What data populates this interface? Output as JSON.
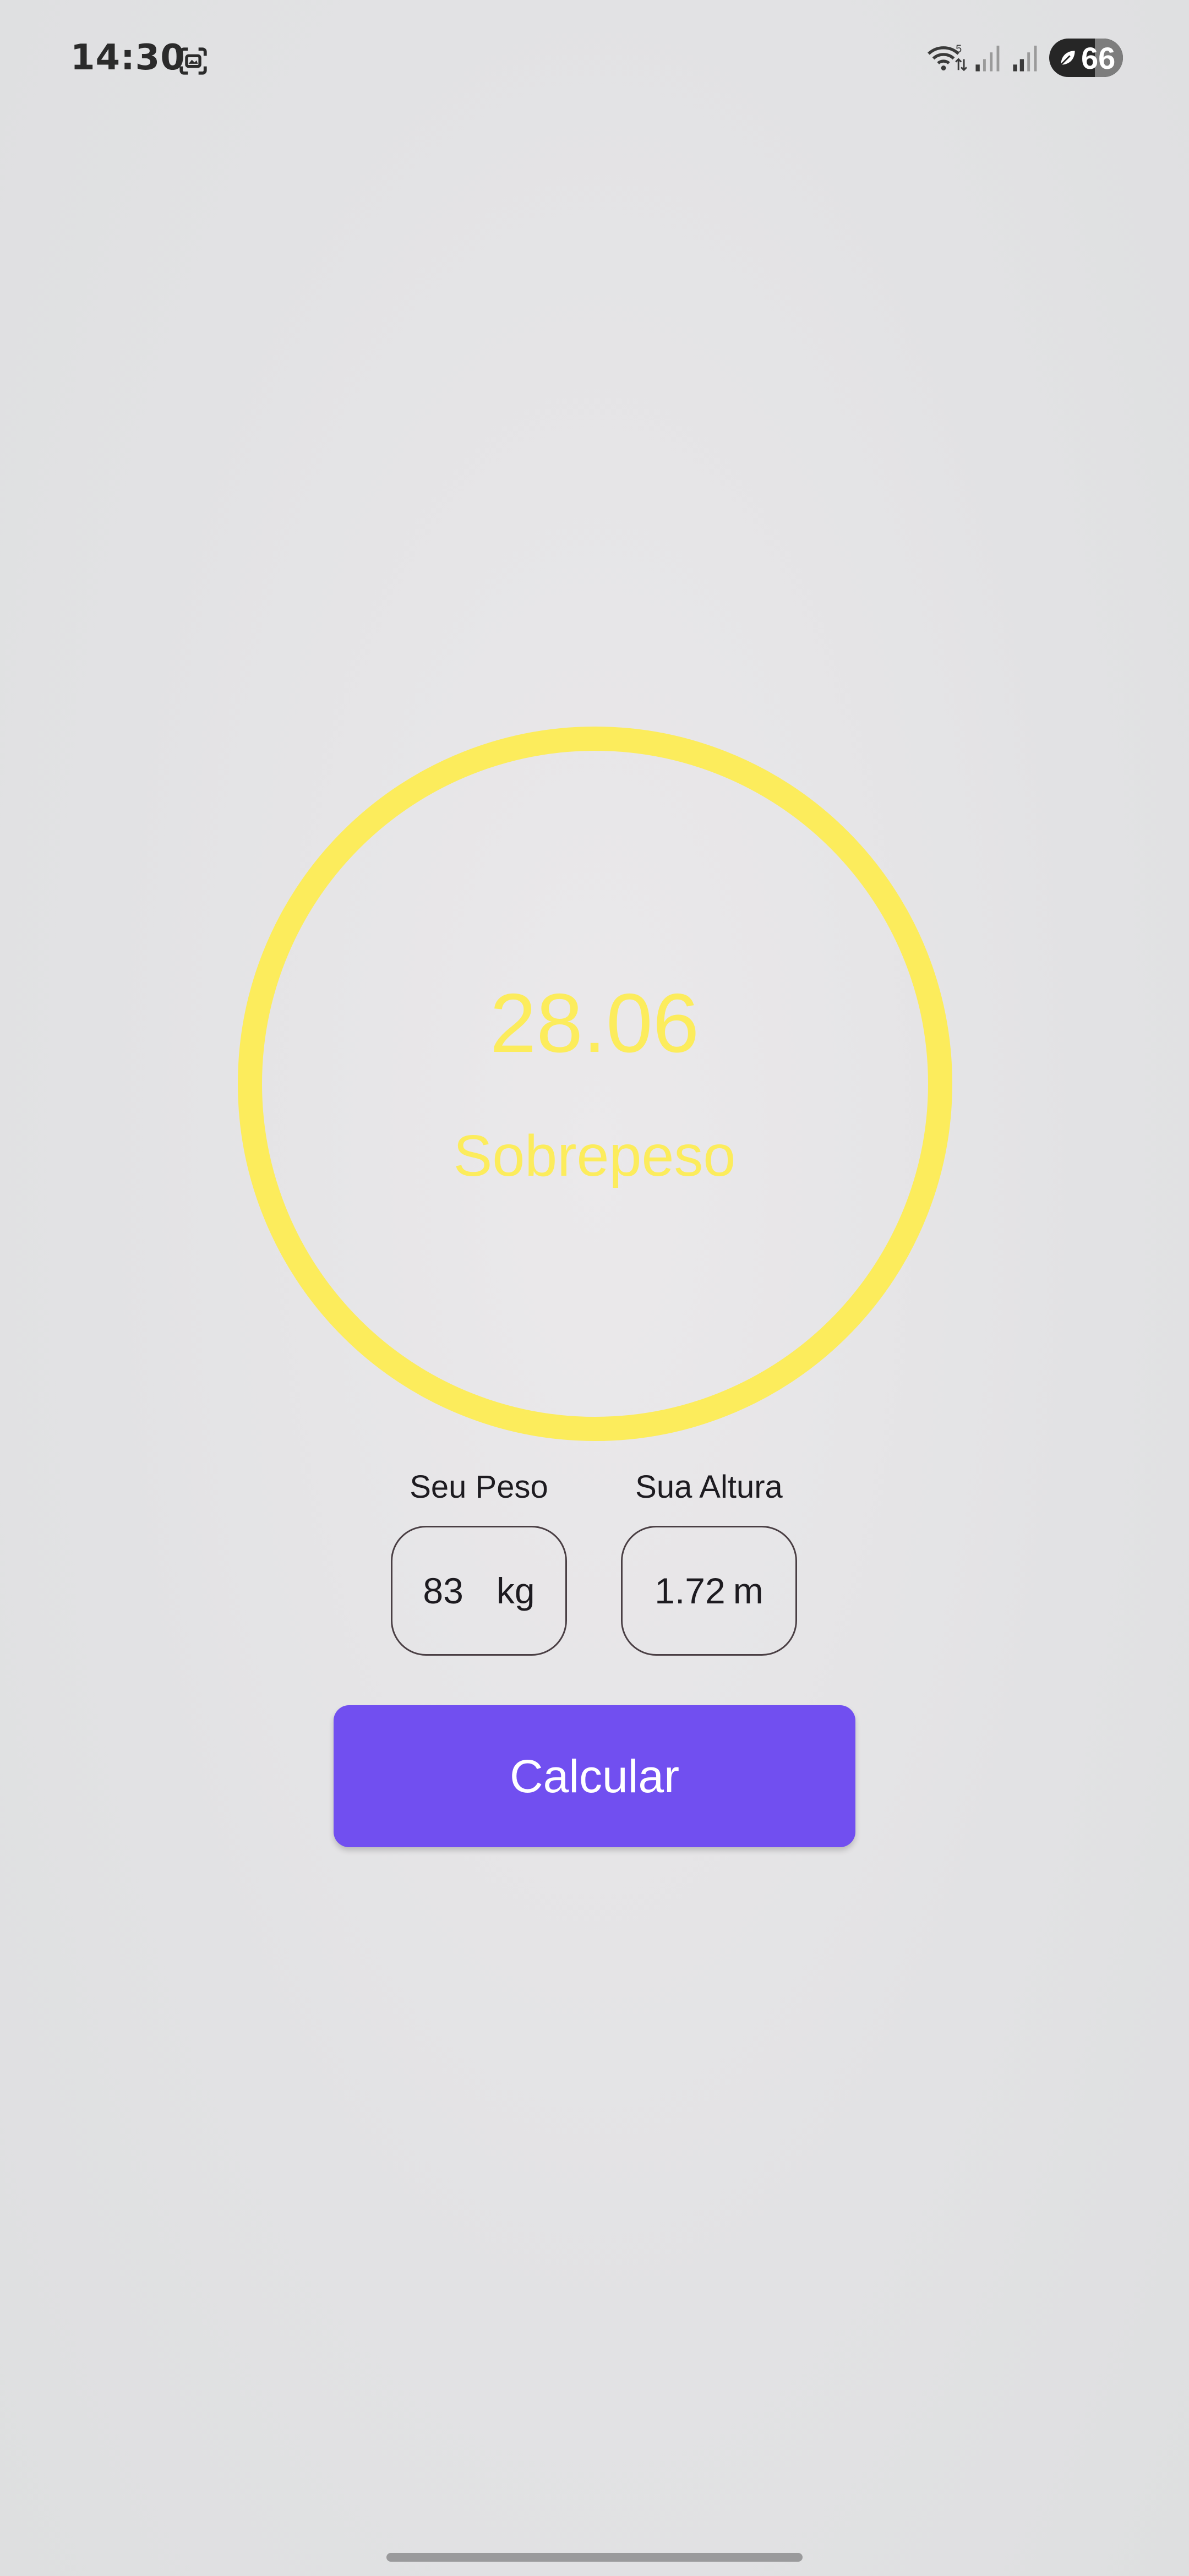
{
  "status_bar": {
    "time": "14:30",
    "battery_level": "66",
    "icons": [
      "screen-record-icon",
      "wifi-icon",
      "signal-icon",
      "signal-icon",
      "battery-icon"
    ]
  },
  "result": {
    "bmi_value": "28.06",
    "category": "Sobrepeso",
    "ring_color": "#fcec5c"
  },
  "inputs": {
    "weight": {
      "label": "Seu Peso",
      "value": "83",
      "unit": "kg"
    },
    "height": {
      "label": "Sua Altura",
      "value": "1.72",
      "unit": "m"
    }
  },
  "actions": {
    "calculate_label": "Calcular",
    "button_color": "#714ff0"
  }
}
